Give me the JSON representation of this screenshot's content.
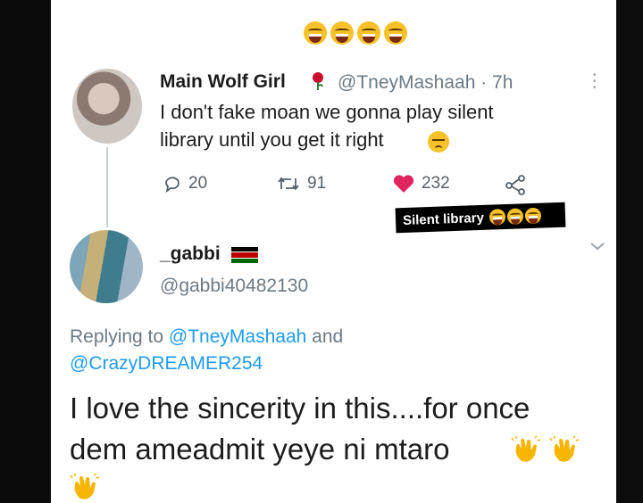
{
  "top_emojis": [
    "laughing-face",
    "laughing-face",
    "laughing-face",
    "laughing-face"
  ],
  "tweet": {
    "display_name": "Main Wolf Girl",
    "handle_time": "@TneyMashaah · 7h",
    "text_line1": "I don't fake moan we gonna play silent",
    "text_line2": "library until you get it right",
    "replies": "20",
    "retweets": "91",
    "likes": "232",
    "like_color": "#e0245e"
  },
  "sticker": {
    "text": "Silent library",
    "emojis": [
      "laughing-face",
      "laughing-face",
      "laughing-face"
    ]
  },
  "reply": {
    "display_name": "_gabbi",
    "handle": "@gabbi40482130",
    "replying_label": "Replying to",
    "replying_to_1": "@TneyMashaah",
    "and_label": "and",
    "replying_to_2": "@CrazyDREAMER254",
    "text_line1": "I love the sincerity in this....for once",
    "text_line2": "dem ameadmit yeye ni mtaro",
    "link_color": "#1d9bf0",
    "icons": [
      "clapping-hands",
      "clapping-hands",
      "clapping-hands"
    ]
  }
}
